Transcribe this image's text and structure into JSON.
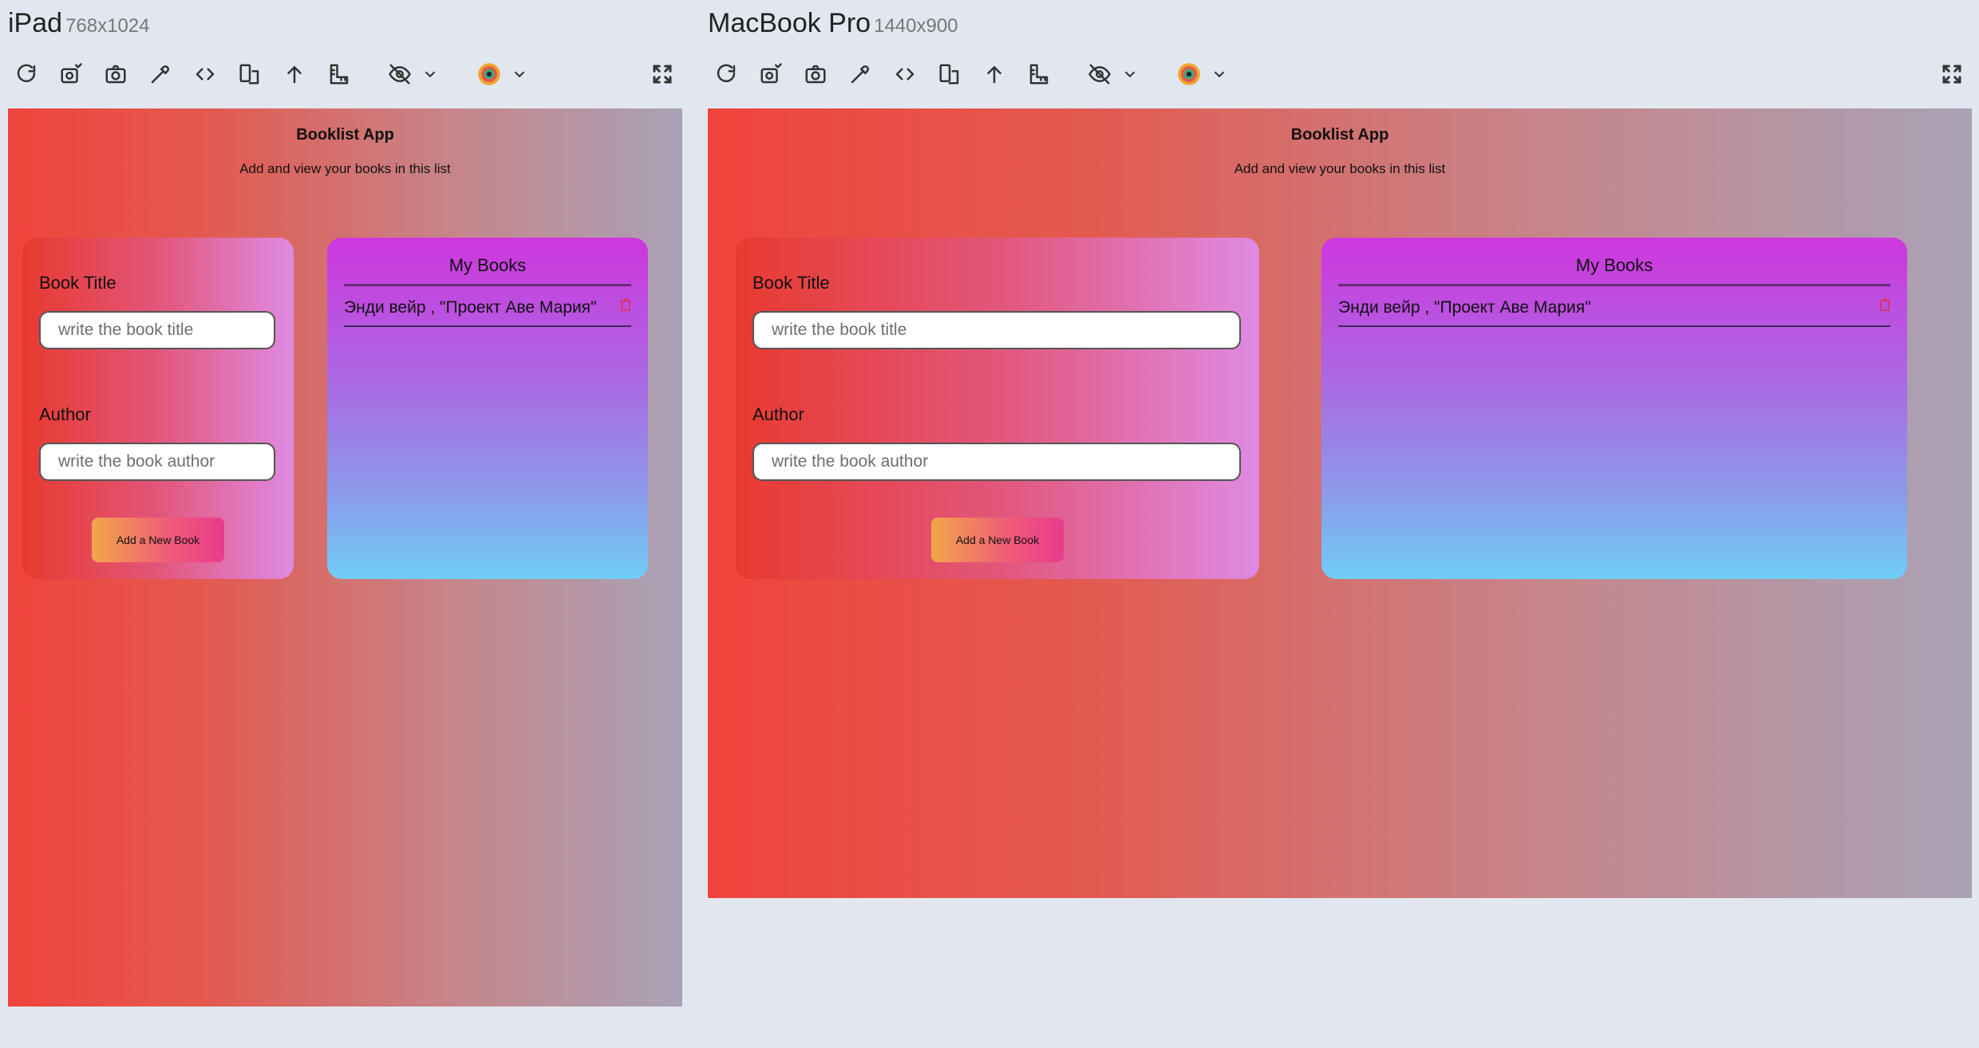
{
  "devices": [
    {
      "name": "iPad",
      "dims": "768x1024"
    },
    {
      "name": "MacBook Pro",
      "dims": "1440x900"
    }
  ],
  "toolbar": {
    "icons": [
      "refresh-icon",
      "camera-settings-icon",
      "camera-icon",
      "eyedropper-icon",
      "code-icon",
      "device-rotate-icon",
      "arrow-up-icon",
      "ruler-icon",
      "eye-off-icon",
      "color-wheel-icon",
      "fullscreen-icon"
    ]
  },
  "app": {
    "title": "Booklist App",
    "subtitle": "Add and view your books in this list",
    "form": {
      "title_label": "Book Title",
      "title_placeholder": "write the book title",
      "author_label": "Author",
      "author_placeholder": "write the book author",
      "add_button": "Add a New Book"
    },
    "books": {
      "heading": "My Books",
      "items": [
        {
          "text": "Энди вейр , \"Проект Аве Мария\""
        }
      ]
    }
  },
  "colors": {
    "page_bg": "#e2e7ef",
    "app_gradient_start": "#ef443c",
    "app_gradient_end": "#a9a2b6",
    "trash": "#e0304a"
  }
}
